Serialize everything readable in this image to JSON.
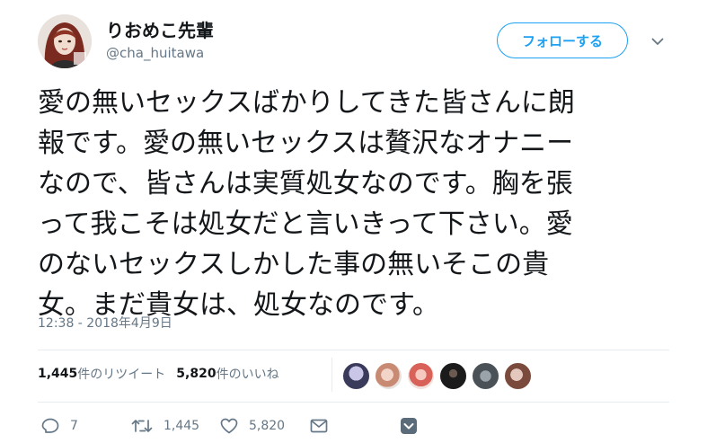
{
  "user": {
    "display_name": "りおめこ先輩",
    "handle": "@cha_huitawa"
  },
  "follow_button": {
    "label": "フォローする",
    "accent_color": "#1da1f2"
  },
  "tweet": {
    "lines": [
      "愛の無いセックスばかりしてきた皆さんに朗",
      "報です。愛の無いセックスは贅沢なオナニー",
      "なので、皆さんは実質処女なのです。胸を張",
      "って我こそは処女だと言いきって下さい。愛",
      "のないセックスしかした事の無いそこの貴",
      "女。まだ貴女は、処女なのです。"
    ],
    "timestamp": "12:38 - 2018年4月9日"
  },
  "stats": {
    "retweet_count": "1,445",
    "retweet_label": "件のリツイート",
    "like_count": "5,820",
    "like_label": "件のいいね"
  },
  "actions": {
    "reply_count": "7",
    "retweet_count": "1,445",
    "like_count": "5,820"
  },
  "icons": [
    "reply-icon",
    "retweet-icon",
    "heart-icon",
    "mail-icon",
    "chevron-down-icon"
  ]
}
